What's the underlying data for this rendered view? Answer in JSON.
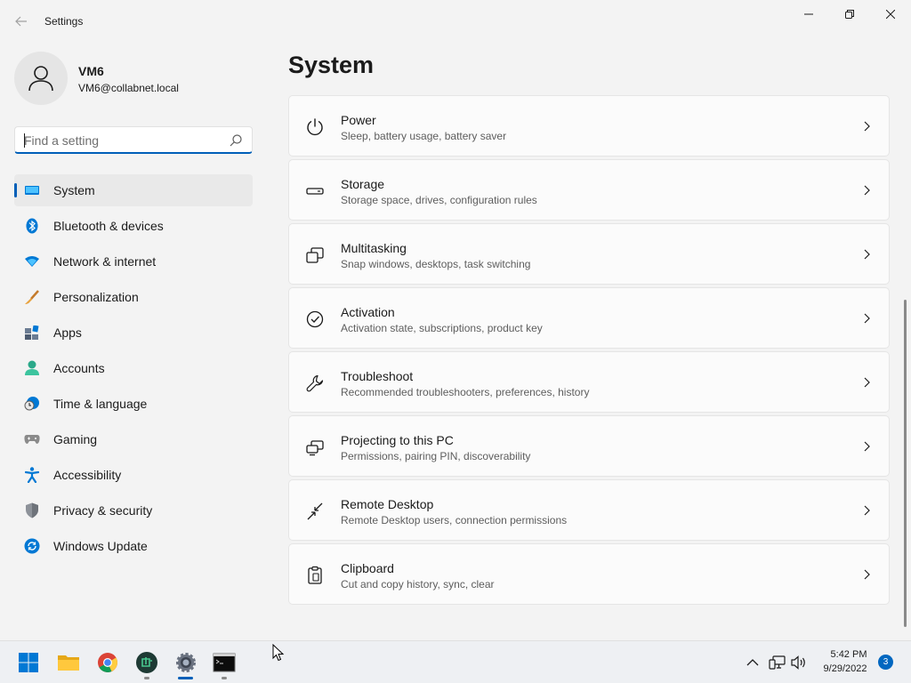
{
  "app": {
    "title": "Settings"
  },
  "user": {
    "name": "VM6",
    "email": "VM6@collabnet.local"
  },
  "search": {
    "placeholder": "Find a setting",
    "value": ""
  },
  "sidebar": {
    "items": [
      {
        "label": "System",
        "icon": "system-icon",
        "selected": true
      },
      {
        "label": "Bluetooth & devices",
        "icon": "bluetooth-icon"
      },
      {
        "label": "Network & internet",
        "icon": "wifi-icon"
      },
      {
        "label": "Personalization",
        "icon": "brush-icon"
      },
      {
        "label": "Apps",
        "icon": "apps-icon"
      },
      {
        "label": "Accounts",
        "icon": "person-icon"
      },
      {
        "label": "Time & language",
        "icon": "clock-globe-icon"
      },
      {
        "label": "Gaming",
        "icon": "gamepad-icon"
      },
      {
        "label": "Accessibility",
        "icon": "accessibility-icon"
      },
      {
        "label": "Privacy & security",
        "icon": "shield-icon"
      },
      {
        "label": "Windows Update",
        "icon": "update-icon"
      }
    ]
  },
  "main": {
    "title": "System",
    "cards": [
      {
        "title": "Power",
        "description": "Sleep, battery usage, battery saver",
        "icon": "power-icon"
      },
      {
        "title": "Storage",
        "description": "Storage space, drives, configuration rules",
        "icon": "storage-icon"
      },
      {
        "title": "Multitasking",
        "description": "Snap windows, desktops, task switching",
        "icon": "multitasking-icon"
      },
      {
        "title": "Activation",
        "description": "Activation state, subscriptions, product key",
        "icon": "check-circle-icon"
      },
      {
        "title": "Troubleshoot",
        "description": "Recommended troubleshooters, preferences, history",
        "icon": "wrench-icon"
      },
      {
        "title": "Projecting to this PC",
        "description": "Permissions, pairing PIN, discoverability",
        "icon": "projecting-icon"
      },
      {
        "title": "Remote Desktop",
        "description": "Remote Desktop users, connection permissions",
        "icon": "remote-desktop-icon"
      },
      {
        "title": "Clipboard",
        "description": "Cut and copy history, sync, clear",
        "icon": "clipboard-icon"
      }
    ]
  },
  "taskbar": {
    "apps": [
      "start-icon",
      "file-explorer-icon",
      "chrome-icon",
      "app-icon",
      "settings-icon",
      "terminal-icon"
    ],
    "clock": {
      "time": "5:42 PM",
      "date": "9/29/2022"
    },
    "notification_count": "3"
  },
  "colors": {
    "accent": "#005fb8",
    "background": "#f3f3f3",
    "card": "#fbfbfb"
  }
}
